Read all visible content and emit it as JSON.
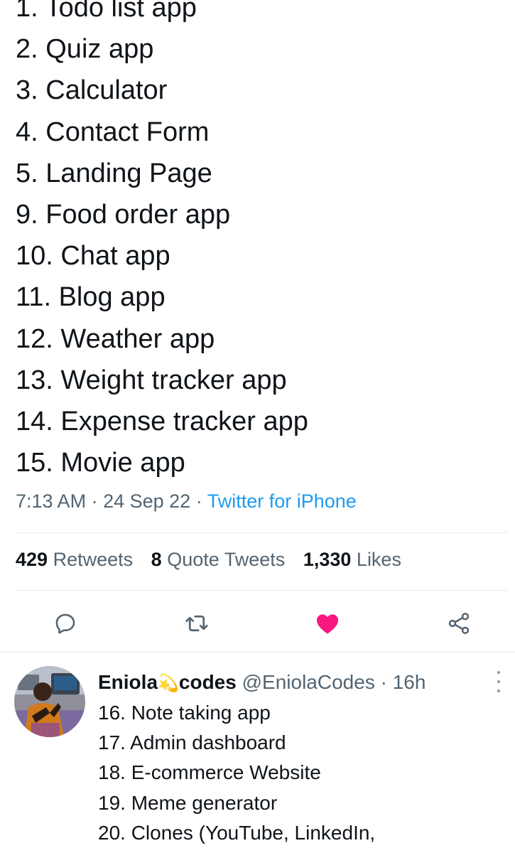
{
  "tweet": {
    "lines": [
      "1. Todo list app",
      "2. Quiz app",
      "3. Calculator",
      "4. Contact Form",
      "5. Landing Page",
      "9. Food order app",
      "10. Chat app",
      "11. Blog app",
      "12. Weather app",
      "13. Weight tracker app",
      "14. Expense tracker app",
      "15. Movie app"
    ],
    "time": "7:13 AM",
    "date": "24 Sep 22",
    "separator": "·",
    "source": "Twitter for iPhone"
  },
  "stats": {
    "retweets_count": "429",
    "retweets_label": "Retweets",
    "quotes_count": "8",
    "quotes_label": "Quote Tweets",
    "likes_count": "1,330",
    "likes_label": "Likes"
  },
  "actions": {
    "reply_icon": "reply-icon",
    "retweet_icon": "retweet-icon",
    "like_icon": "heart-icon",
    "share_icon": "share-icon",
    "liked_color": "#f91880",
    "icon_color": "#536471"
  },
  "reply": {
    "display_name_part1": "Eniola",
    "sparkle_icon": "dizzy-emoji",
    "display_name_part2": "codes",
    "handle": "@EniolaCodes",
    "separator": "·",
    "time_ago": "16h",
    "lines": [
      "16. Note taking app",
      "17. Admin dashboard",
      "18. E-commerce Website",
      "19. Meme generator",
      "20. Clones (YouTube, LinkedIn,"
    ]
  },
  "colors": {
    "text_primary": "#0f1419",
    "text_secondary": "#536471",
    "link": "#1d9bf0",
    "like": "#f91880"
  }
}
